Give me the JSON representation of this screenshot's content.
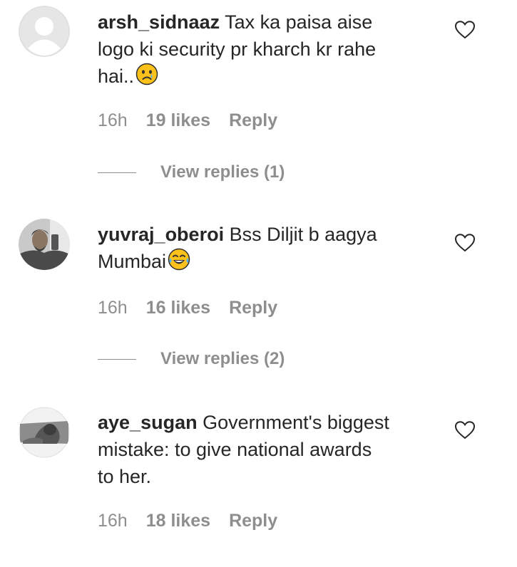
{
  "comments": [
    {
      "username": "arsh_sidnaaz",
      "text_line1": "Tax ka paisa aise",
      "text_line2": "logo ki security pr kharch kr rahe",
      "text_line3": "hai..",
      "emoji": "crying-face",
      "time": "16h",
      "likes": "19 likes",
      "reply": "Reply",
      "view_replies": "View replies (1)",
      "avatar": "default-avatar"
    },
    {
      "username": "yuvraj_oberoi",
      "text_line1": "Bss Diljit b aagya",
      "text_line2": "Mumbai",
      "emoji": "tears-of-joy",
      "time": "16h",
      "likes": "16 likes",
      "reply": "Reply",
      "view_replies": "View replies (2)",
      "avatar": "photo-avatar"
    },
    {
      "username": "aye_sugan",
      "text_line1": "Government's biggest",
      "text_line2": "mistake: to give national awards",
      "text_line3": "to her.",
      "time": "16h",
      "likes": "18 likes",
      "reply": "Reply",
      "avatar": "photo-avatar"
    }
  ],
  "icons": {
    "like": "heart-outline-icon"
  },
  "colors": {
    "text": "#262626",
    "secondary": "#8e8e8e",
    "emoji_face": "#fcc21b"
  }
}
